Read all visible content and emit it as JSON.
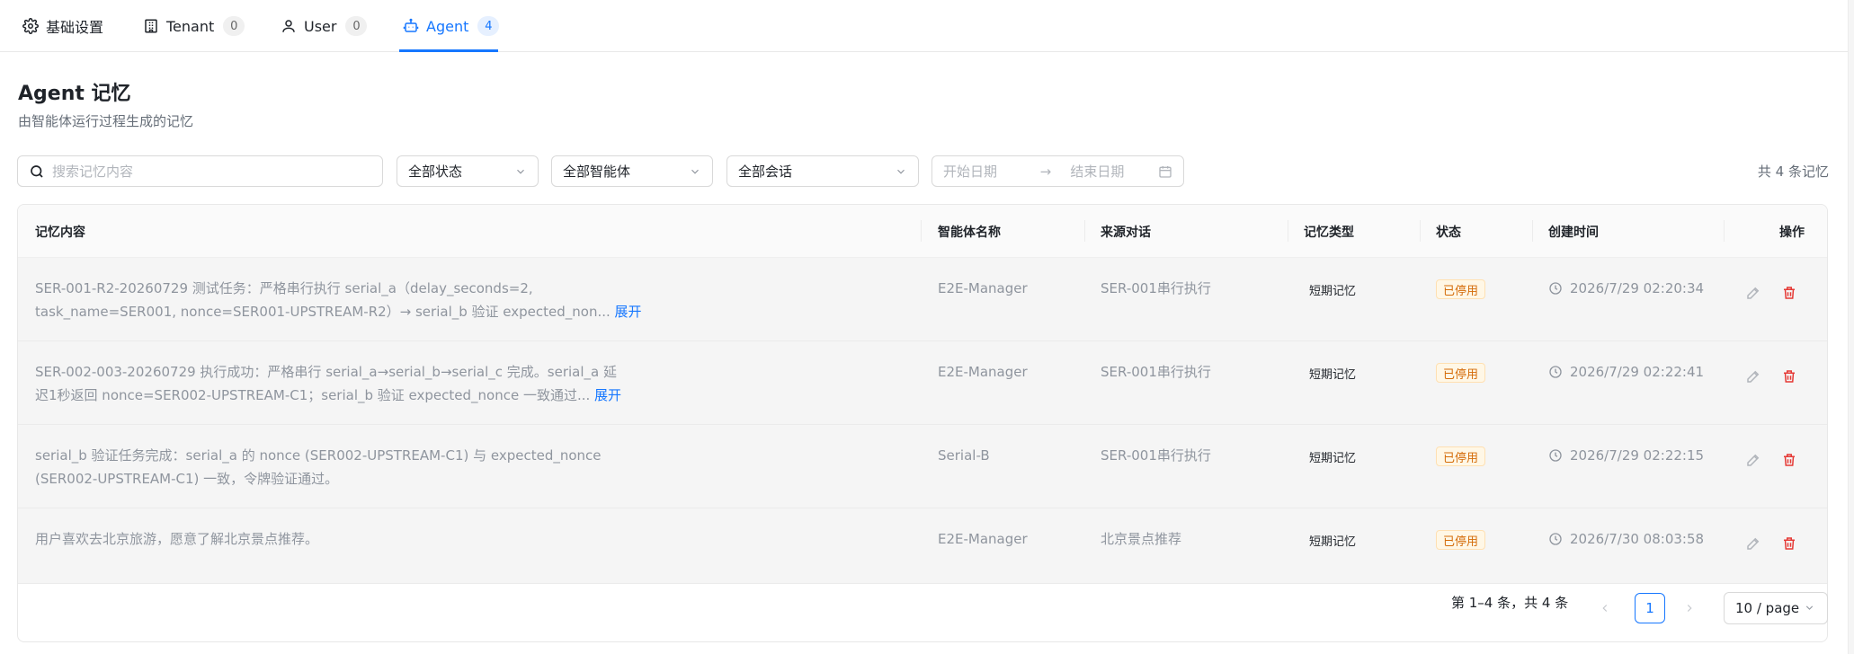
{
  "tabs": [
    {
      "label": "基础设置",
      "icon": "gear-icon"
    },
    {
      "label": "Tenant",
      "icon": "building-icon",
      "count": "0"
    },
    {
      "label": "User",
      "icon": "user-icon",
      "count": "0"
    },
    {
      "label": "Agent",
      "icon": "robot-icon",
      "count": "4",
      "active": true
    }
  ],
  "header": {
    "title": "Agent 记忆",
    "subtitle": "由智能体运行过程生成的记忆"
  },
  "filters": {
    "search_placeholder": "搜索记忆内容",
    "status_select": "全部状态",
    "agent_select": "全部智能体",
    "session_select": "全部会话",
    "start_date_placeholder": "开始日期",
    "end_date_placeholder": "结束日期",
    "date_separator": "→",
    "total_text": "共 4 条记忆"
  },
  "table": {
    "columns": [
      "记忆内容",
      "智能体名称",
      "来源对话",
      "记忆类型",
      "状态",
      "创建时间",
      "操作"
    ],
    "expand_label": "展开",
    "rows": [
      {
        "content_line1": "SER-001-R2-20260729 测试任务：严格串行执行 serial_a（delay_seconds=2,",
        "content_line2": "task_name=SER001, nonce=SER001-UPSTREAM-R2）→ serial_b 验证 expected_non...",
        "has_expand": true,
        "agent": "E2E-Manager",
        "source": "SER-001串行执行",
        "type": "短期记忆",
        "status": "已停用",
        "created": "2026/7/29 02:20:34"
      },
      {
        "content_line1": "SER-002-003-20260729 执行成功：严格串行 serial_a→serial_b→serial_c 完成。serial_a 延",
        "content_line2": "迟1秒返回 nonce=SER002-UPSTREAM-C1；serial_b 验证 expected_nonce 一致通过...",
        "has_expand": true,
        "agent": "E2E-Manager",
        "source": "SER-001串行执行",
        "type": "短期记忆",
        "status": "已停用",
        "created": "2026/7/29 02:22:41"
      },
      {
        "content_line1": "serial_b 验证任务完成：serial_a 的 nonce (SER002-UPSTREAM-C1) 与 expected_nonce",
        "content_line2": "(SER002-UPSTREAM-C1) 一致，令牌验证通过。",
        "has_expand": false,
        "agent": "Serial-B",
        "source": "SER-001串行执行",
        "type": "短期记忆",
        "status": "已停用",
        "created": "2026/7/29 02:22:15"
      },
      {
        "content_line1": "用户喜欢去北京旅游，愿意了解北京景点推荐。",
        "content_line2": "",
        "has_expand": false,
        "agent": "E2E-Manager",
        "source": "北京景点推荐",
        "type": "短期记忆",
        "status": "已停用",
        "created": "2026/7/30 08:03:58"
      }
    ]
  },
  "pagination": {
    "summary": "第 1–4 条，共 4 条",
    "current_page": "1",
    "page_size": "10 / page"
  },
  "colors": {
    "accent": "#1677ff",
    "danger": "#e53935",
    "status_tag": "#d46b08"
  }
}
